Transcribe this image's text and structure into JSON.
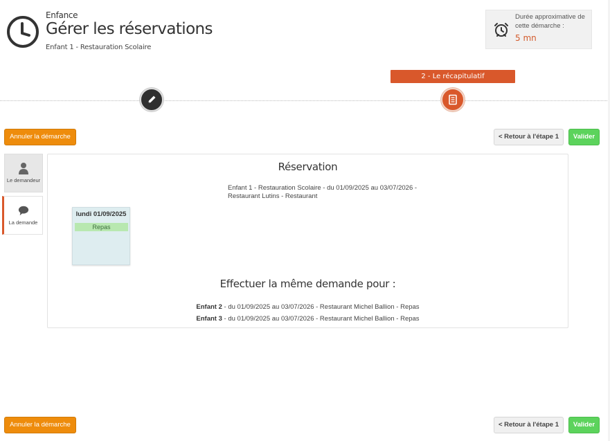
{
  "header": {
    "category": "Enfance",
    "title": "Gérer les réservations",
    "subtitle": "Enfant 1 - Restauration Scolaire"
  },
  "duration": {
    "label": "Durée approximative de cette démarche :",
    "value": "5 mn"
  },
  "steps": {
    "current_label": "2 - Le récapitulatif"
  },
  "actions": {
    "cancel_label": "Annuler la démarche",
    "back_label": "< Retour à l'étape 1",
    "validate_label": "Valider"
  },
  "sidebar": {
    "items": [
      {
        "label": "Le demandeur",
        "icon": "user-icon"
      },
      {
        "label": "La demande",
        "icon": "speech-bubble-icon"
      }
    ]
  },
  "panel": {
    "title": "Réservation",
    "description": "Enfant 1 - Restauration Scolaire - du 01/09/2025 au 03/07/2026 - Restaurant Lutins - Restaurant",
    "day": {
      "date": "lundi 01/09/2025",
      "meal": "Repas"
    },
    "same_request_title": "Effectuer la même demande pour :",
    "same_request": [
      {
        "child": "Enfant 2",
        "details": " - du 01/09/2025 au 03/07/2026 - Restaurant Michel Ballion - Repas"
      },
      {
        "child": "Enfant 3",
        "details": " - du 01/09/2025 au 03/07/2026 - Restaurant Michel Ballion - Repas"
      }
    ]
  },
  "colors": {
    "accent": "#d9582b",
    "cancel": "#ee8c0c",
    "validate": "#5cd35c"
  }
}
